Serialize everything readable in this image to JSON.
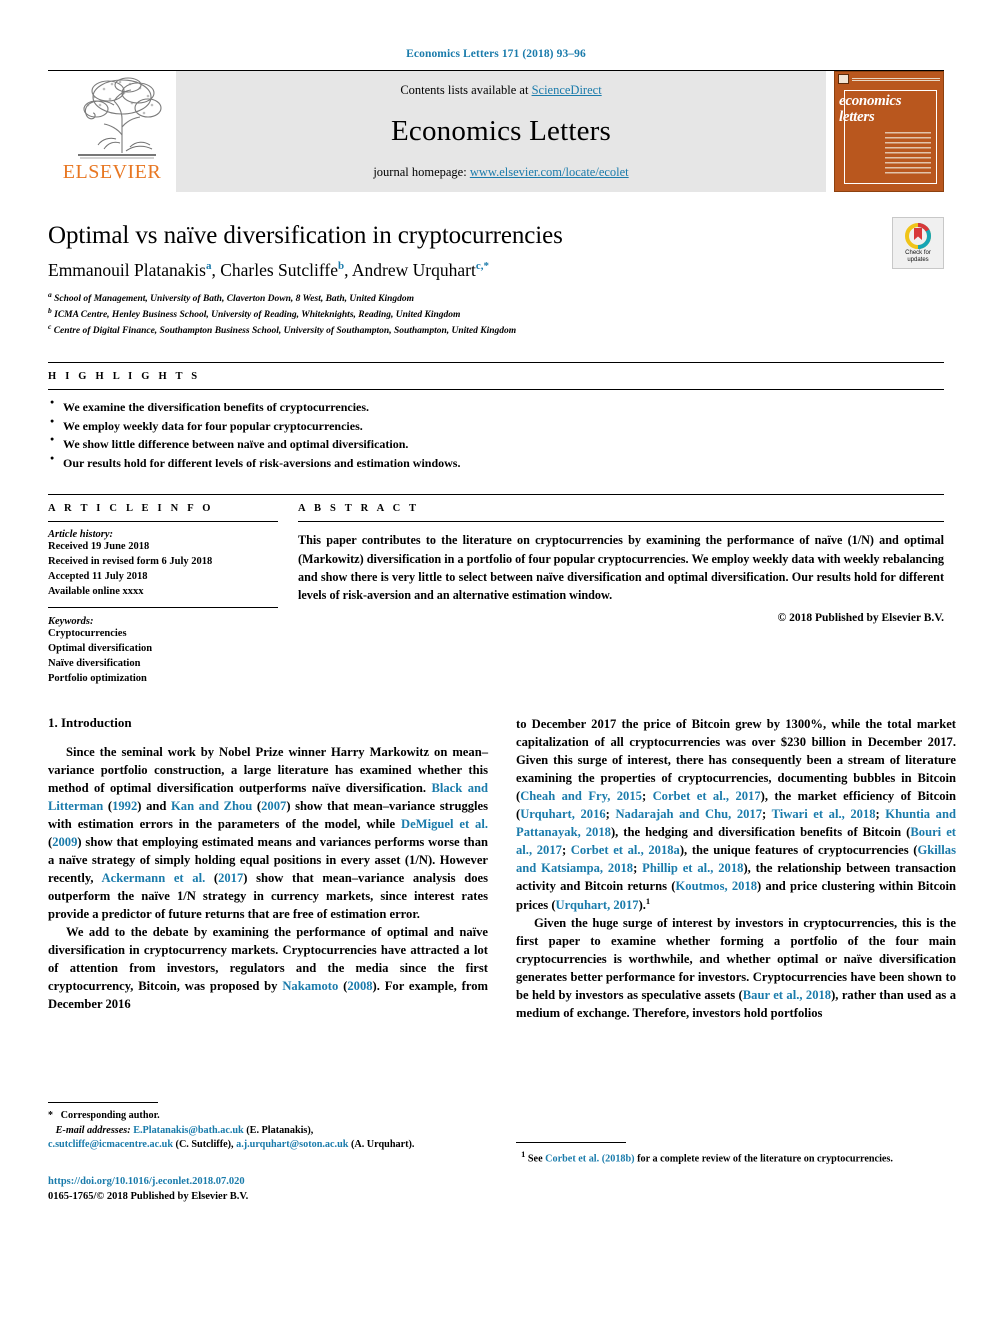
{
  "running_head": "Economics Letters 171 (2018) 93–96",
  "masthead": {
    "publisher_name": "ELSEVIER",
    "contents_prefix": "Contents lists available at ",
    "contents_link": "ScienceDirect",
    "journal_name": "Economics Letters",
    "homepage_prefix": "journal homepage: ",
    "homepage_link": "www.elsevier.com/locate/ecolet",
    "cover_title_line1": "economics",
    "cover_title_line2": "letters"
  },
  "article": {
    "title": "Optimal vs naïve diversification in cryptocurrencies",
    "authors": [
      {
        "name": "Emmanouil Platanakis",
        "marks": "a",
        "sep": ", "
      },
      {
        "name": "Charles Sutcliffe",
        "marks": "b",
        "sep": ", "
      },
      {
        "name": "Andrew Urquhart",
        "marks": "c,*",
        "sep": ""
      }
    ],
    "affiliations": [
      {
        "mark": "a",
        "text": "School of Management, University of Bath, Claverton Down, 8 West, Bath, United Kingdom"
      },
      {
        "mark": "b",
        "text": "ICMA Centre, Henley Business School, University of Reading, Whiteknights, Reading, United Kingdom"
      },
      {
        "mark": "c",
        "text": "Centre of Digital Finance, Southampton Business School, University of Southampton, Southampton, United Kingdom"
      }
    ],
    "crossmark_label_line1": "Check for",
    "crossmark_label_line2": "updates"
  },
  "highlights": {
    "heading": "H I G H L I G H T S",
    "items": [
      "We examine the diversification benefits of cryptocurrencies.",
      "We employ weekly data for four popular cryptocurrencies.",
      "We show little difference between naïve and optimal diversification.",
      "Our results hold for different levels of risk-aversions and estimation windows."
    ]
  },
  "article_info": {
    "heading": "A R T I C L E    I N F O",
    "history_label": "Article history:",
    "history": [
      "Received 19 June 2018",
      "Received in revised form 6 July 2018",
      "Accepted 11 July 2018",
      "Available online xxxx"
    ],
    "keywords_label": "Keywords:",
    "keywords": [
      "Cryptocurrencies",
      "Optimal diversification",
      "Naïve diversification",
      "Portfolio optimization"
    ]
  },
  "abstract": {
    "heading": "A B S T R A C T",
    "text": "This paper contributes to the literature on cryptocurrencies by examining the performance of naïve (1/N) and optimal (Markowitz) diversification in a portfolio of four popular cryptocurrencies. We employ weekly data with weekly rebalancing and show there is very little to select between naïve diversification and optimal diversification. Our results hold for different levels of risk-aversion and an alternative estimation window.",
    "copyright": "© 2018 Published by Elsevier B.V."
  },
  "body": {
    "section_title": "1. Introduction",
    "left_paragraph_1": "Since the seminal work by Nobel Prize winner Harry Markowitz on mean–variance portfolio construction, a large literature has examined whether this method of optimal diversification outperforms naïve diversification. Black and Litterman (1992) and Kan and Zhou (2007) show that mean–variance struggles with estimation errors in the parameters of the model, while DeMiguel et al. (2009) show that employing estimated means and variances performs worse than a naïve strategy of simply holding equal positions in every asset (1/N). However recently, Ackermann et al. (2017) show that mean–variance analysis does outperform the naïve 1/N strategy in currency markets, since interest rates provide a predictor of future returns that are free of estimation error.",
    "left_paragraph_2": "We add to the debate by examining the performance of optimal and naïve diversification in cryptocurrency markets. Cryptocurrencies have attracted a lot of attention from investors, regulators and the media since the first cryptocurrency, Bitcoin, was proposed by Nakamoto (2008). For example, from December 2016",
    "right_paragraph_1": "to December 2017 the price of Bitcoin grew by 1300%, while the total market capitalization of all cryptocurrencies was over $230 billion in December 2017. Given this surge of interest, there has consequently been a stream of literature examining the properties of cryptocurrencies, documenting bubbles in Bitcoin (Cheah and Fry, 2015; Corbet et al., 2017), the market efficiency of Bitcoin (Urquhart, 2016; Nadarajah and Chu, 2017; Tiwari et al., 2018; Khuntia and Pattanayak, 2018), the hedging and diversification benefits of Bitcoin (Bouri et al., 2017; Corbet et al., 2018a), the unique features of cryptocurrencies (Gkillas and Katsiampa, 2018; Phillip et al., 2018), the relationship between transaction activity and Bitcoin returns (Koutmos, 2018) and price clustering within Bitcoin prices (Urquhart, 2017).",
    "right_paragraph_2": "Given the huge surge of interest by investors in cryptocurrencies, this is the first paper to examine whether forming a portfolio of the four main cryptocurrencies is worthwhile, and whether optimal or naïve diversification generates better performance for investors. Cryptocurrencies have been shown to be held by investors as speculative assets (Baur et al., 2018), rather than used as a medium of exchange. Therefore, investors hold portfolios"
  },
  "footnotes": {
    "corresponding_mark": "*",
    "corresponding_text": "Corresponding author.",
    "email_label": "E-mail addresses:",
    "emails": [
      {
        "address": "E.Platanakis@bath.ac.uk",
        "owner": "(E. Platanakis),"
      },
      {
        "address": "c.sutcliffe@icmacentre.ac.uk",
        "owner": "(C. Sutcliffe),"
      },
      {
        "address": "a.j.urquhart@soton.ac.uk",
        "owner": "(A. Urquhart)."
      }
    ],
    "right_number": "1",
    "right_text_pre": "See ",
    "right_link": "Corbet et al. (2018b)",
    "right_text_post": " for a complete review of the literature on cryptocurrencies."
  },
  "footer": {
    "doi": "https://doi.org/10.1016/j.econlet.2018.07.020",
    "issn_line": "0165-1765/© 2018 Published by Elsevier B.V."
  },
  "colors": {
    "link_blue": "#1a7bab",
    "elsevier_orange": "#e87722",
    "banner_gray": "#e6e6e6",
    "cover_orange": "#b9571e"
  }
}
